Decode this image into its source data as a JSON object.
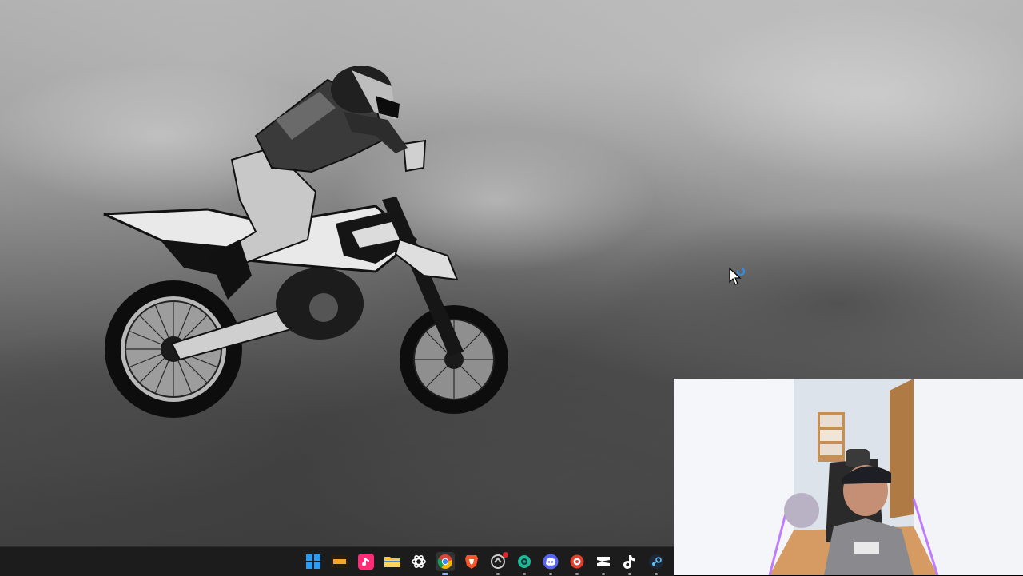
{
  "desktop": {
    "wallpaper": "motocross-jump-sky",
    "sky_tone": "#8a8a8a"
  },
  "cursor": {
    "type": "arrow-busy",
    "accent": "#2f8fe8"
  },
  "webcam_overlay": {
    "subject": "streamer-in-gaming-chair",
    "accent": "#c07cff"
  },
  "taskbar": {
    "background": "#1c1c1c",
    "apps": [
      {
        "name": "start",
        "icon": "windows-logo-icon",
        "color": "#2b9cf4",
        "state": "idle"
      },
      {
        "name": "app-1",
        "icon": "logo-tile-icon",
        "color": "#f5a623",
        "state": "idle"
      },
      {
        "name": "app-2",
        "icon": "tiktok-tile-icon",
        "color": "#ff2d78",
        "state": "idle"
      },
      {
        "name": "file-explorer",
        "icon": "folder-icon",
        "color": "#f6c343",
        "state": "idle"
      },
      {
        "name": "chatgpt",
        "icon": "openai-icon",
        "color": "#ffffff",
        "state": "idle"
      },
      {
        "name": "chrome",
        "icon": "chrome-icon",
        "color": "#4285f4",
        "state": "active"
      },
      {
        "name": "brave",
        "icon": "brave-lion-icon",
        "color": "#fb542b",
        "state": "idle"
      },
      {
        "name": "app-8",
        "icon": "circle-badge-icon",
        "color": "#cccccc",
        "state": "running",
        "badge": true
      },
      {
        "name": "app-9",
        "icon": "teal-gear-icon",
        "color": "#1fb89a",
        "state": "running"
      },
      {
        "name": "discord",
        "icon": "discord-icon",
        "color": "#5865f2",
        "state": "running"
      },
      {
        "name": "app-11",
        "icon": "red-wheel-icon",
        "color": "#e2402f",
        "state": "running"
      },
      {
        "name": "capcut",
        "icon": "capcut-icon",
        "color": "#ffffff",
        "state": "running"
      },
      {
        "name": "tiktok",
        "icon": "tiktok-icon",
        "color": "#ffffff",
        "state": "running"
      },
      {
        "name": "steam",
        "icon": "steam-icon",
        "color": "#66c0f4",
        "state": "running"
      }
    ]
  }
}
